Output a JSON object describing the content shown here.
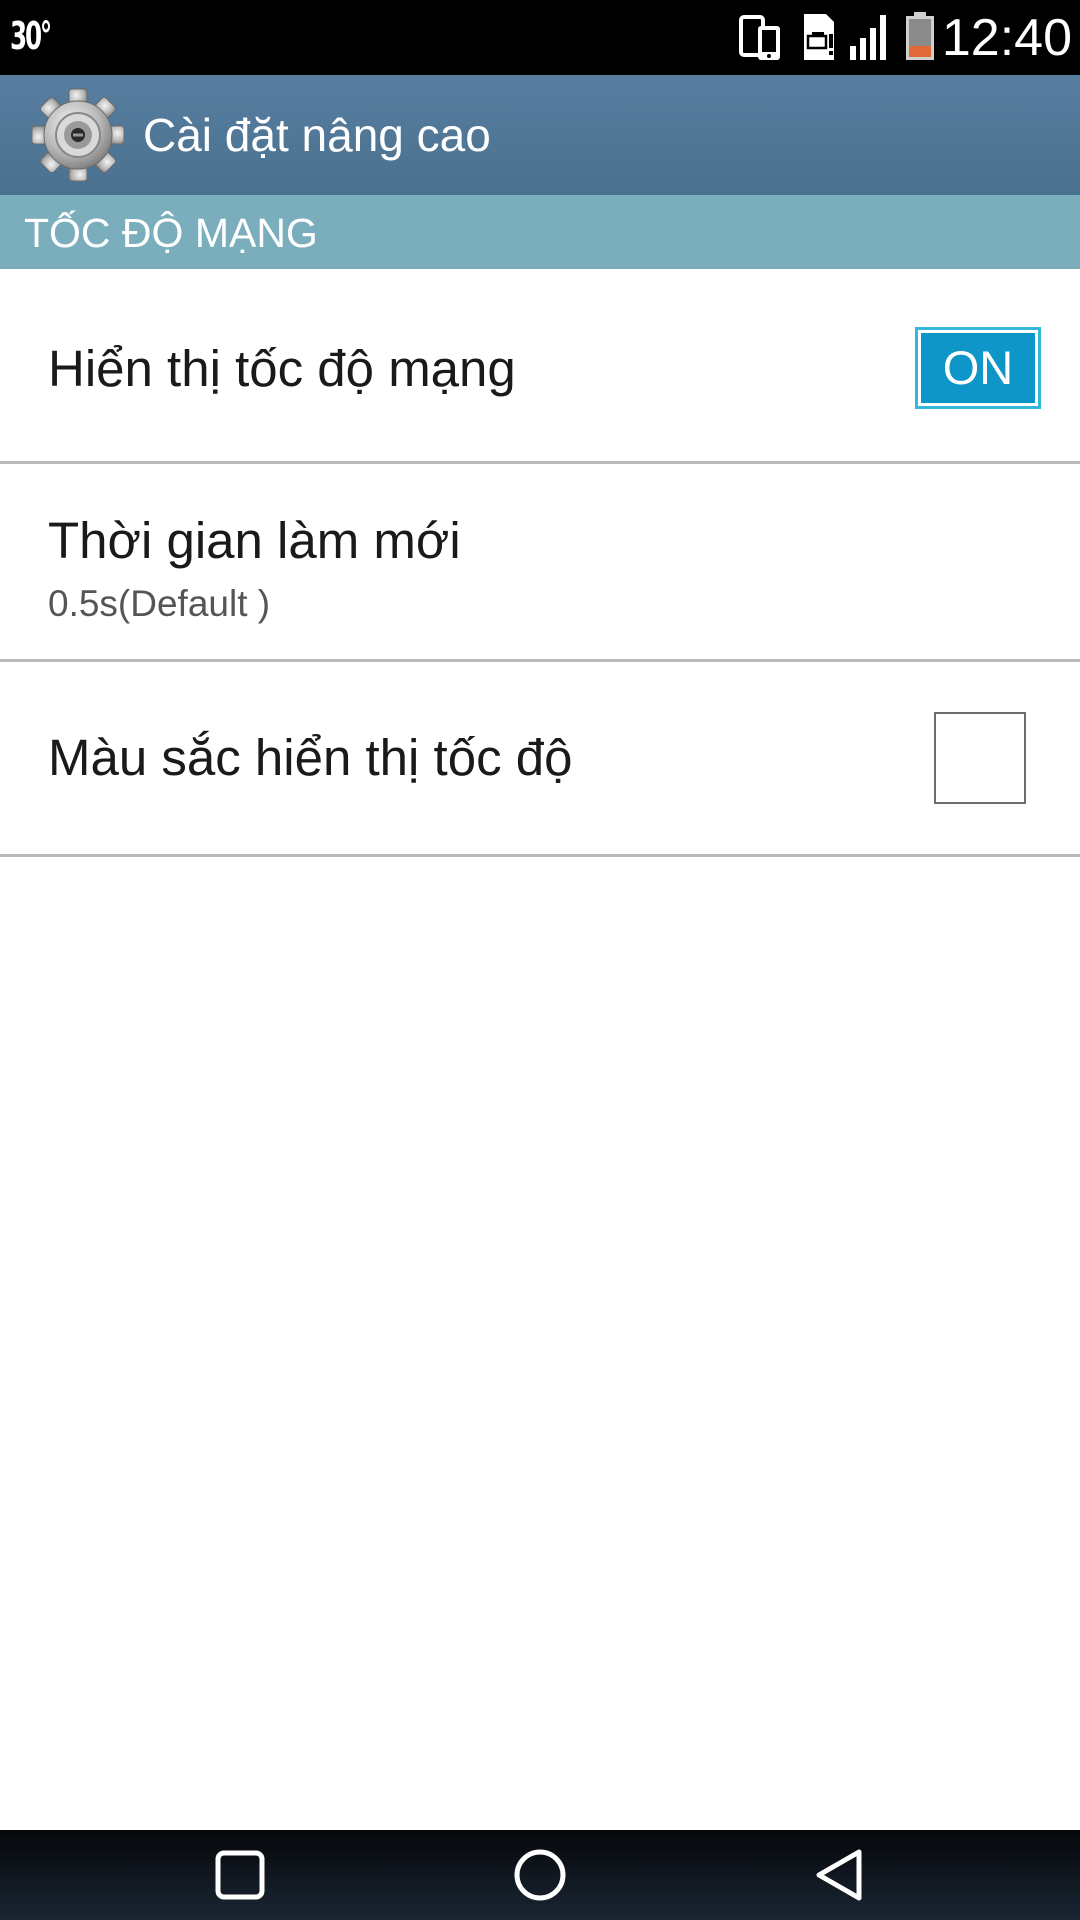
{
  "status_bar": {
    "temperature": "30°",
    "time": "12:40",
    "icons": [
      "phone-link-icon",
      "sd-card-icon",
      "signal-icon",
      "battery-low-icon"
    ]
  },
  "action_bar": {
    "icon": "settings-gear-icon",
    "title": "Cài đặt nâng cao"
  },
  "section": {
    "title": "TỐC ĐỘ MẠNG"
  },
  "settings": {
    "show_speed": {
      "title": "Hiển thị tốc độ mạng",
      "toggle_label": "ON",
      "enabled": true
    },
    "refresh_time": {
      "title": "Thời gian làm mới",
      "summary": "0.5s(Default )"
    },
    "speed_color": {
      "title": "Màu sắc hiển thị tốc độ",
      "checked": false
    }
  },
  "nav_bar": {
    "buttons": [
      "recent-apps-icon",
      "home-icon",
      "back-icon"
    ]
  },
  "colors": {
    "action_bar": "#4f7594",
    "section_header": "#7aaebd",
    "toggle_on": "#0d96c7",
    "battery_level": "#e0693a"
  }
}
